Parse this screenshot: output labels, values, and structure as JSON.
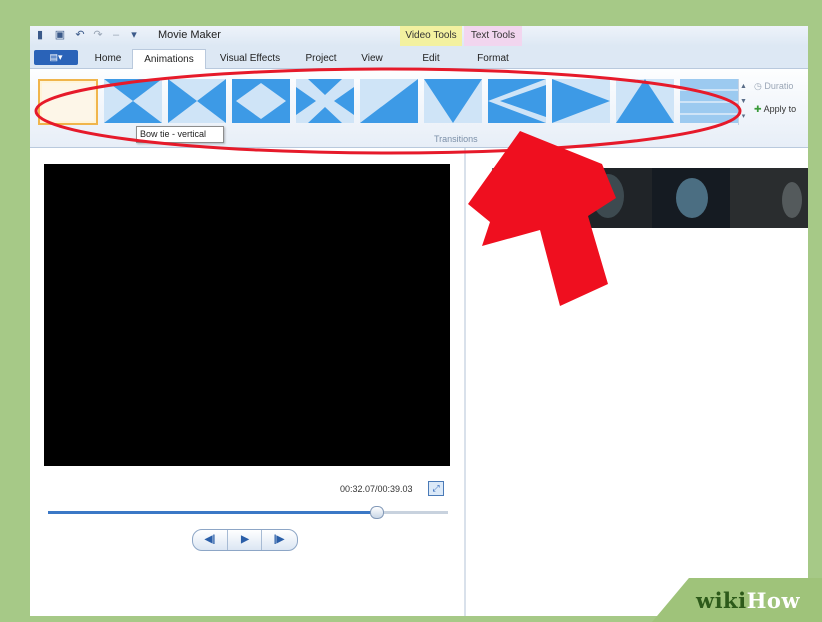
{
  "app": {
    "title": "Movie Maker"
  },
  "context_tabs": [
    {
      "label": "Video Tools",
      "color": "#f3f1a0"
    },
    {
      "label": "Text Tools",
      "color": "#f2d6ef"
    }
  ],
  "file_button": {
    "label": "▤▾"
  },
  "tabs": [
    {
      "label": "Home",
      "active": false
    },
    {
      "label": "Animations",
      "active": true
    },
    {
      "label": "Visual Effects",
      "active": false
    },
    {
      "label": "Project",
      "active": false
    },
    {
      "label": "View",
      "active": false
    },
    {
      "label": "Edit",
      "active": false
    },
    {
      "label": "Format",
      "active": false
    }
  ],
  "ribbon": {
    "group_label": "Transitions",
    "transitions": [
      {
        "icon": "no-transition-icon",
        "selected": true
      },
      {
        "icon": "bow-tie-vertical-icon",
        "selected": false
      },
      {
        "icon": "bow-tie-horizontal-icon",
        "selected": false
      },
      {
        "icon": "diamond-icon",
        "selected": false
      },
      {
        "icon": "cross-icon",
        "selected": false
      },
      {
        "icon": "diagonal-icon",
        "selected": false
      },
      {
        "icon": "chevron-down-icon",
        "selected": false
      },
      {
        "icon": "chevron-left-icon",
        "selected": false
      },
      {
        "icon": "chevron-right-icon",
        "selected": false
      },
      {
        "icon": "chevron-up-icon",
        "selected": false
      },
      {
        "icon": "bars-icon",
        "selected": false
      }
    ],
    "duration_label": "Duratio",
    "apply_label": "Apply to"
  },
  "tooltip": {
    "text": "Bow tie - vertical"
  },
  "player": {
    "time": "00:32.07/00:39.03",
    "progress": 0.82,
    "prev_label": "◀|",
    "play_label": "▶",
    "next_label": "|▶"
  },
  "watermark": {
    "part1": "wiki",
    "part2": "How"
  },
  "colors": {
    "arrow": "#ef0f1f",
    "highlight_oval": "#e61a2a",
    "accent": "#2a63b8"
  }
}
